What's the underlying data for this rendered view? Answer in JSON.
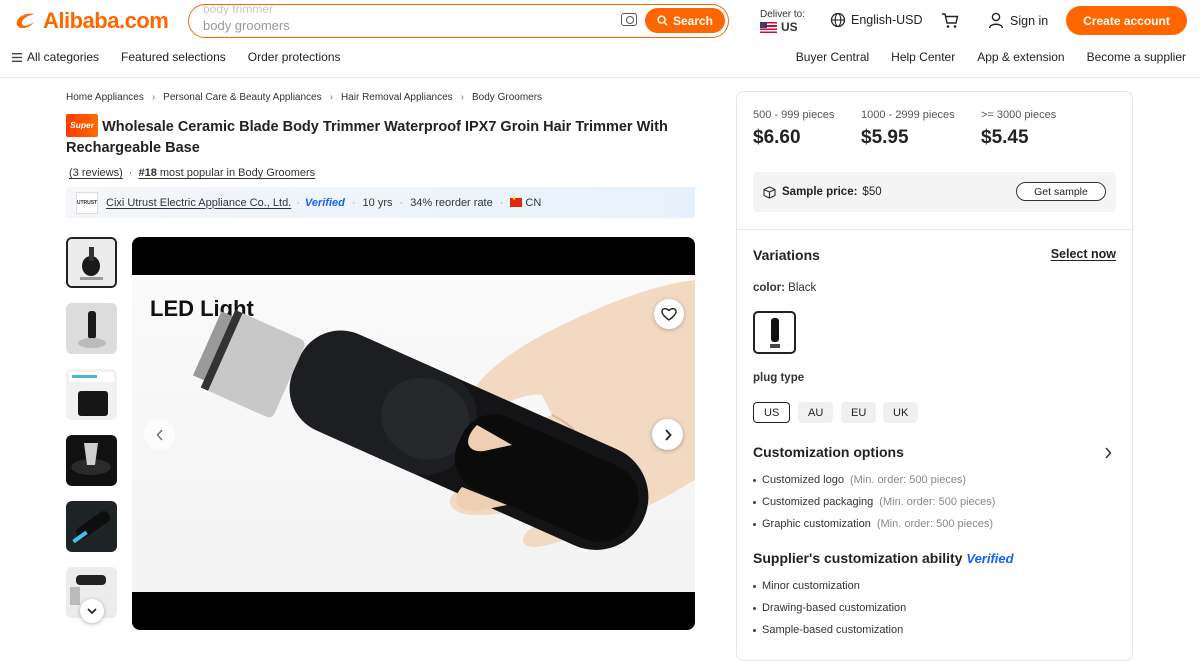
{
  "header": {
    "logo_text": "Alibaba.com",
    "search_ghost": "body trimmer",
    "search_value": "body groomers",
    "search_button": "Search",
    "deliver_label": "Deliver to:",
    "deliver_country": "US",
    "language": "English-USD",
    "sign_in": "Sign in",
    "create_account": "Create account",
    "accent": "#ff6600"
  },
  "nav": {
    "left": [
      "All categories",
      "Featured selections",
      "Order protections"
    ],
    "right": [
      "Buyer Central",
      "Help Center",
      "App & extension",
      "Become a supplier"
    ]
  },
  "breadcrumb": [
    "Home Appliances",
    "Personal Care & Beauty Appliances",
    "Hair Removal Appliances",
    "Body Groomers"
  ],
  "product": {
    "badge": "Super",
    "title": "Wholesale Ceramic Blade Body Trimmer Waterproof IPX7 Groin Hair Trimmer With Rechargeable Base",
    "reviews": "(3 reviews)",
    "rank_num": "#18",
    "rank_text": "most popular in Body Groomers",
    "image_caption": "LED Light"
  },
  "supplier": {
    "logo_text": "UTRUST",
    "name": "Cixi Utrust Electric Appliance Co., Ltd.",
    "verified": "Verified",
    "years": "10 yrs",
    "reorder": "34% reorder rate",
    "country": "CN"
  },
  "pricing": {
    "tiers": [
      {
        "qty": "500 - 999 pieces",
        "price": "$6.60"
      },
      {
        "qty": "1000 - 2999 pieces",
        "price": "$5.95"
      },
      {
        "qty": ">= 3000 pieces",
        "price": "$5.45"
      }
    ],
    "sample_label": "Sample price:",
    "sample_price": "$50",
    "get_sample": "Get sample"
  },
  "variations": {
    "title": "Variations",
    "select_now": "Select now",
    "color_label": "color:",
    "color_value": "Black",
    "plug_label": "plug type",
    "plug_options": [
      "US",
      "AU",
      "EU",
      "UK"
    ],
    "plug_selected": "US"
  },
  "customization": {
    "title": "Customization options",
    "items": [
      {
        "name": "Customized logo",
        "min": "(Min. order: 500 pieces)"
      },
      {
        "name": "Customized packaging",
        "min": "(Min. order: 500 pieces)"
      },
      {
        "name": "Graphic customization",
        "min": "(Min. order: 500 pieces)"
      }
    ]
  },
  "ability": {
    "title": "Supplier's customization ability",
    "verified": "Verified",
    "items": [
      "Minor customization",
      "Drawing-based customization",
      "Sample-based customization"
    ]
  }
}
